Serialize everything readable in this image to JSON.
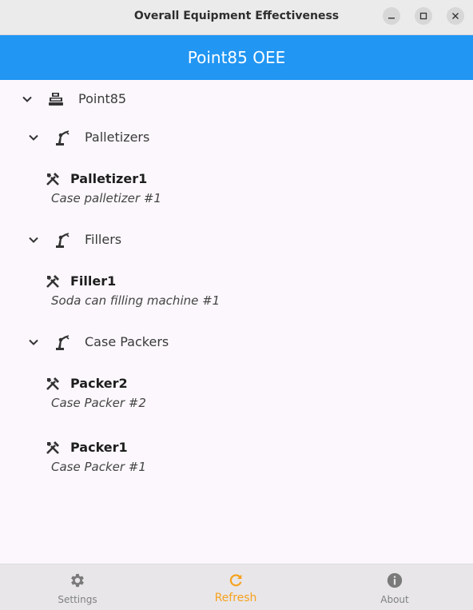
{
  "window": {
    "title": "Overall Equipment Effectiveness"
  },
  "appbar": {
    "title": "Point85 OEE",
    "color": "#2196f3"
  },
  "tree": {
    "root": {
      "label": "Point85",
      "icon": "enterprise-icon",
      "expanded": true
    },
    "areas": [
      {
        "label": "Palletizers",
        "icon": "robot-arm-icon",
        "expanded": true,
        "equipment": [
          {
            "name": "Palletizer1",
            "description": "Case palletizer #1",
            "icon": "tools-icon"
          }
        ]
      },
      {
        "label": "Fillers",
        "icon": "robot-arm-icon",
        "expanded": true,
        "equipment": [
          {
            "name": "Filler1",
            "description": "Soda can filling machine #1",
            "icon": "tools-icon"
          }
        ]
      },
      {
        "label": "Case Packers",
        "icon": "robot-arm-icon",
        "expanded": true,
        "equipment": [
          {
            "name": "Packer2",
            "description": "Case Packer #2",
            "icon": "tools-icon"
          },
          {
            "name": "Packer1",
            "description": "Case Packer #1",
            "icon": "tools-icon"
          }
        ]
      }
    ]
  },
  "bottom_nav": {
    "selected": "Refresh",
    "accent": "#f6a21d",
    "items": [
      {
        "label": "Settings",
        "icon": "gear-icon"
      },
      {
        "label": "Refresh",
        "icon": "refresh-icon"
      },
      {
        "label": "About",
        "icon": "info-icon"
      }
    ]
  }
}
